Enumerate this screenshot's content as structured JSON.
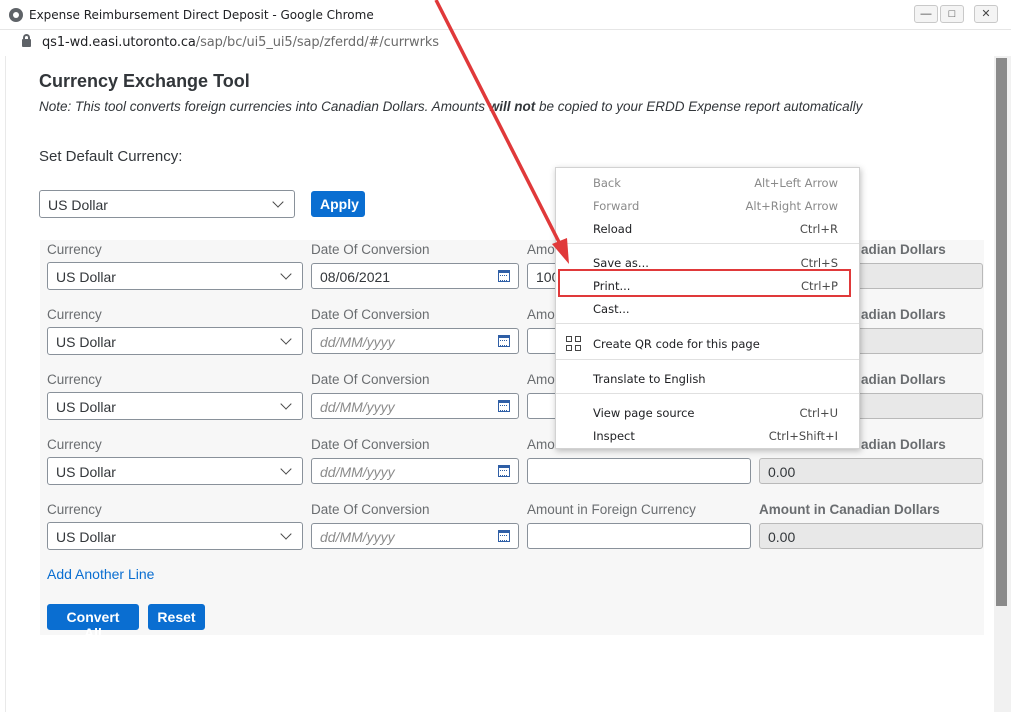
{
  "window": {
    "title": "Expense Reimbursement Direct Deposit - Google Chrome",
    "url_host": "qs1-wd.easi.utoronto.ca",
    "url_path": "/sap/bc/ui5_ui5/sap/zferdd/#/currwrks",
    "minimize": "—",
    "maximize": "□",
    "close": "✕"
  },
  "page": {
    "title": "Currency Exchange Tool",
    "note_before": "Note: This tool converts foreign currencies into Canadian Dollars. Amounts ",
    "note_bold": "will not",
    "note_after": " be copied to your ERDD Expense report automatically",
    "default_label": "Set Default Currency:",
    "default_currency": "US Dollar",
    "apply": "Apply",
    "add_line": "Add Another Line",
    "convert_all": "Convert All",
    "reset": "Reset"
  },
  "columns": {
    "currency": "Currency",
    "date": "Date Of Conversion",
    "amount_foreign": "Amount in Foreign Currency",
    "amount_cad": "Amount in Canadian Dollars"
  },
  "rows": [
    {
      "currency": "US Dollar",
      "date": "08/06/2021",
      "amount": "100",
      "cad_label": "adian Dollars",
      "cad": "",
      "amount_label": "Amo"
    },
    {
      "currency": "US Dollar",
      "date": "dd/MM/yyyy",
      "amount": "",
      "cad_label": "adian Dollars",
      "cad": "",
      "amount_label": "Amo"
    },
    {
      "currency": "US Dollar",
      "date": "dd/MM/yyyy",
      "amount": "",
      "cad_label": "adian Dollars",
      "cad": "",
      "amount_label": "Amo"
    },
    {
      "currency": "US Dollar",
      "date": "dd/MM/yyyy",
      "amount": "",
      "cad_label": "adian Dollars",
      "cad": "0.00",
      "amount_label": "Amo"
    },
    {
      "currency": "US Dollar",
      "date": "dd/MM/yyyy",
      "amount": "",
      "cad_label": "Amount in Canadian Dollars",
      "cad": "0.00",
      "amount_label": "Amount in Foreign Currency"
    }
  ],
  "context_menu": {
    "items": [
      {
        "label": "Back",
        "shortcut": "Alt+Left Arrow",
        "disabled": true
      },
      {
        "label": "Forward",
        "shortcut": "Alt+Right Arrow",
        "disabled": true
      },
      {
        "label": "Reload",
        "shortcut": "Ctrl+R"
      },
      {
        "label": "Save as...",
        "shortcut": "Ctrl+S"
      },
      {
        "label": "Print...",
        "shortcut": "Ctrl+P"
      },
      {
        "label": "Cast...",
        "shortcut": ""
      },
      {
        "label": "Create QR code for this page",
        "shortcut": "",
        "icon": "qr-code-icon"
      },
      {
        "label": "Translate to English",
        "shortcut": ""
      },
      {
        "label": "View page source",
        "shortcut": "Ctrl+U"
      },
      {
        "label": "Inspect",
        "shortcut": "Ctrl+Shift+I"
      }
    ]
  },
  "annotation": {
    "arrow_color": "#e0393a",
    "highlight_color": "#e0393a",
    "highlighted_item": "Print..."
  }
}
